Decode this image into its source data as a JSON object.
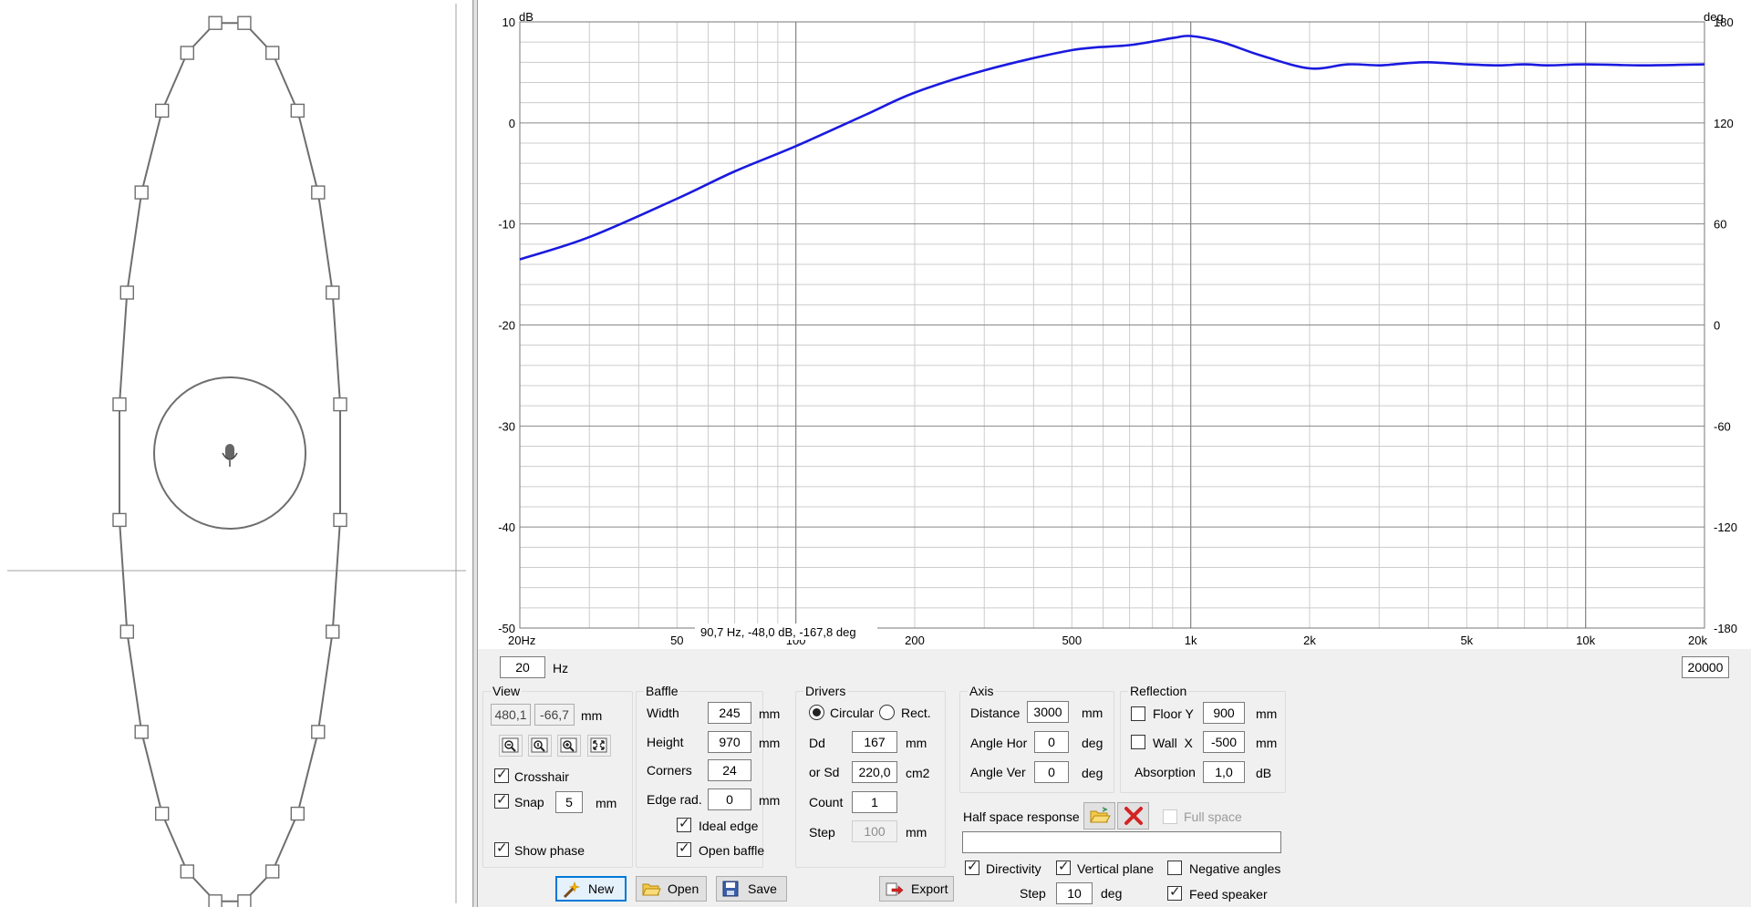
{
  "colors": {
    "curve": "#1a1adf",
    "grid_major": "#888888",
    "grid_minor": "#cccccc",
    "baffle_outline": "#6e6e6e",
    "focus_border": "#0078d7",
    "delete_red": "#d42323"
  },
  "graph": {
    "left_axis_unit": "dB",
    "right_axis_unit": "deg",
    "left_ticks": [
      "10",
      "0",
      "-10",
      "-20",
      "-30",
      "-40",
      "-50"
    ],
    "right_ticks": [
      "180",
      "120",
      "60",
      "0",
      "-60",
      "-120",
      "-180"
    ],
    "x_ticks": [
      "20Hz",
      "50",
      "100",
      "200",
      "500",
      "1k",
      "2k",
      "5k",
      "10k",
      "20k"
    ],
    "cursor_readout": "90,7 Hz, -48,0 dB, -167,8 deg",
    "freq_min": "20",
    "freq_unit": "Hz",
    "freq_max": "20000"
  },
  "chart_data": {
    "type": "line",
    "xscale": "log",
    "xlim": [
      20,
      20000
    ],
    "ylim": [
      -50,
      10
    ],
    "y2lim": [
      -180,
      180
    ],
    "xlabel": "Hz",
    "ylabel": "dB",
    "y2label": "deg",
    "grid": true,
    "series": [
      {
        "x": [
          20,
          30,
          50,
          70,
          100,
          150,
          200,
          300,
          500,
          700,
          900,
          1000,
          1200,
          1500,
          2000,
          2500,
          3000,
          3500,
          4000,
          5000,
          6000,
          7000,
          8000,
          10000,
          14000,
          20000
        ],
        "y": [
          -13.5,
          -11.3,
          -7.5,
          -4.8,
          -2.3,
          0.8,
          3.0,
          5.2,
          7.2,
          7.7,
          8.4,
          8.6,
          8.0,
          6.7,
          5.4,
          5.8,
          5.7,
          5.9,
          6.0,
          5.8,
          5.7,
          5.8,
          5.7,
          5.8,
          5.7,
          5.8
        ]
      }
    ]
  },
  "view": {
    "title": "View",
    "x_value": "480,1",
    "y_value": "-66,7",
    "unit": "mm",
    "crosshair_label": "Crosshair",
    "crosshair_checked": true,
    "snap_label": "Snap",
    "snap_checked": true,
    "snap_value": "5",
    "snap_unit": "mm",
    "show_phase_label": "Show phase",
    "show_phase_checked": true
  },
  "baffle": {
    "title": "Baffle",
    "width_label": "Width",
    "width_value": "245",
    "width_unit": "mm",
    "height_label": "Height",
    "height_value": "970",
    "height_unit": "mm",
    "corners_label": "Corners",
    "corners_value": "24",
    "edge_label": "Edge rad.",
    "edge_value": "0",
    "edge_unit": "mm",
    "ideal_edge_label": "Ideal edge",
    "ideal_edge_checked": true,
    "open_baffle_label": "Open baffle",
    "open_baffle_checked": true
  },
  "drivers": {
    "title": "Drivers",
    "circular_label": "Circular",
    "circular_selected": true,
    "rect_label": "Rect.",
    "dd_label": "Dd",
    "dd_value": "167",
    "dd_unit": "mm",
    "sd_label": "or Sd",
    "sd_value": "220,0",
    "sd_unit": "cm2",
    "count_label": "Count",
    "count_value": "1",
    "step_label": "Step",
    "step_value": "100",
    "step_unit": "mm"
  },
  "axis": {
    "title": "Axis",
    "distance_label": "Distance",
    "distance_value": "3000",
    "distance_unit": "mm",
    "angle_hor_label": "Angle Hor",
    "angle_hor_value": "0",
    "angle_hor_unit": "deg",
    "angle_ver_label": "Angle Ver",
    "angle_ver_value": "0",
    "angle_ver_unit": "deg"
  },
  "reflection": {
    "title": "Reflection",
    "floor_label": "Floor Y",
    "floor_checked": false,
    "floor_value": "900",
    "floor_unit": "mm",
    "wall_label": "Wall  X",
    "wall_checked": false,
    "wall_value": "-500",
    "wall_unit": "mm",
    "absorption_label": "Absorption",
    "absorption_value": "1,0",
    "absorption_unit": "dB"
  },
  "half_space": {
    "label": "Half space response",
    "full_space_label": "Full space",
    "full_space_checked": false,
    "file_value": ""
  },
  "options": {
    "directivity_label": "Directivity",
    "directivity_checked": true,
    "vertical_plane_label": "Vertical plane",
    "vertical_plane_checked": true,
    "negative_angles_label": "Negative angles",
    "negative_angles_checked": false,
    "step_label": "Step",
    "step_value": "10",
    "step_unit": "deg",
    "feed_speaker_label": "Feed speaker",
    "feed_speaker_checked": true
  },
  "buttons": {
    "new": "New",
    "open": "Open",
    "save": "Save",
    "export": "Export"
  }
}
